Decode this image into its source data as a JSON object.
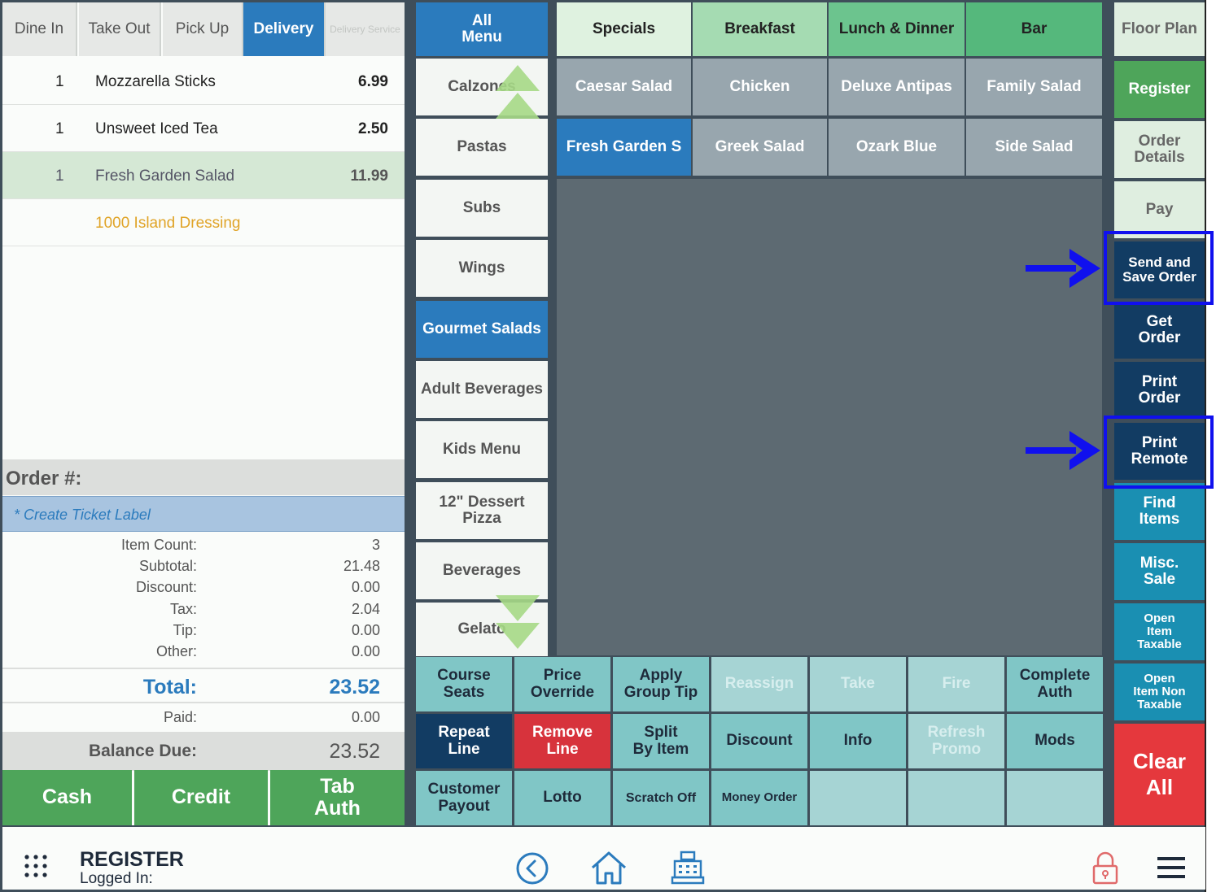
{
  "order_types": [
    {
      "label": "Dine In"
    },
    {
      "label": "Take Out"
    },
    {
      "label": "Pick Up"
    },
    {
      "label": "Delivery"
    },
    {
      "label": "Delivery Service"
    }
  ],
  "order_lines": [
    {
      "qty": "1",
      "name": "Mozzarella Sticks",
      "price": "6.99"
    },
    {
      "qty": "1",
      "name": "Unsweet Iced Tea",
      "price": "2.50"
    },
    {
      "qty": "1",
      "name": "Fresh Garden Salad",
      "price": "11.99"
    },
    {
      "qty": "",
      "name": "1000 Island Dressing",
      "price": ""
    }
  ],
  "order_number_label": "Order #:",
  "ticket_label": "* Create Ticket Label",
  "totals": {
    "item_count_label": "Item Count:",
    "item_count": "3",
    "subtotal_label": "Subtotal:",
    "subtotal": "21.48",
    "discount_label": "Discount:",
    "discount": "0.00",
    "tax_label": "Tax:",
    "tax": "2.04",
    "tip_label": "Tip:",
    "tip": "0.00",
    "other_label": "Other:",
    "other": "0.00",
    "total_label": "Total:",
    "total": "23.52",
    "paid_label": "Paid:",
    "paid": "0.00",
    "balance_label": "Balance Due:",
    "balance": "23.52"
  },
  "payment": {
    "cash": "Cash",
    "credit": "Credit",
    "tab_auth": "Tab\nAuth"
  },
  "nav": {
    "all_menu": "All\nMenu",
    "items": [
      "Calzones",
      "Pastas",
      "Subs",
      "Wings",
      "Gourmet Salads",
      "Adult Beverages",
      "Kids Menu",
      "12\" Dessert\nPizza",
      "Beverages",
      "Gelato"
    ]
  },
  "categories": [
    "Specials",
    "Breakfast",
    "Lunch & Dinner",
    "Bar"
  ],
  "menu_items": [
    "Caesar Salad",
    "Chicken",
    "Deluxe Antipas",
    "Family Salad",
    "Fresh Garden S",
    "Greek Salad",
    "Ozark Blue",
    "Side Salad"
  ],
  "functions": {
    "row1": [
      "Course\nSeats",
      "Price\nOverride",
      "Apply\nGroup Tip",
      "Reassign",
      "Take",
      "Fire",
      "Complete\nAuth"
    ],
    "row2": [
      "Repeat\nLine",
      "Remove\nLine",
      "Split\nBy Item",
      "Discount",
      "Info",
      "Refresh\nPromo",
      "Mods"
    ],
    "row3": [
      "Customer\nPayout",
      "Lotto",
      "Scratch Off",
      "Money Order"
    ]
  },
  "right_column": {
    "floor_plan": "Floor Plan",
    "register": "Register",
    "order_details": "Order\nDetails",
    "pay": "Pay",
    "send_save": "Send and\nSave Order",
    "get_order": "Get\nOrder",
    "print_order": "Print\nOrder",
    "print_remote": "Print\nRemote",
    "find_items": "Find\nItems",
    "misc_sale": "Misc.\nSale",
    "open_item_taxable": "Open\nItem\nTaxable",
    "open_item_non_taxable": "Open\nItem Non\nTaxable",
    "clear_all": "Clear\nAll"
  },
  "footer": {
    "register_label": "REGISTER",
    "logged_in": "Logged In:"
  },
  "colors": {
    "accent_blue": "#2b7bbd",
    "navy": "#123c63",
    "green": "#4ea55a",
    "teal": "#80c6c6",
    "red": "#d7333c",
    "highlight": "#1010ee"
  }
}
